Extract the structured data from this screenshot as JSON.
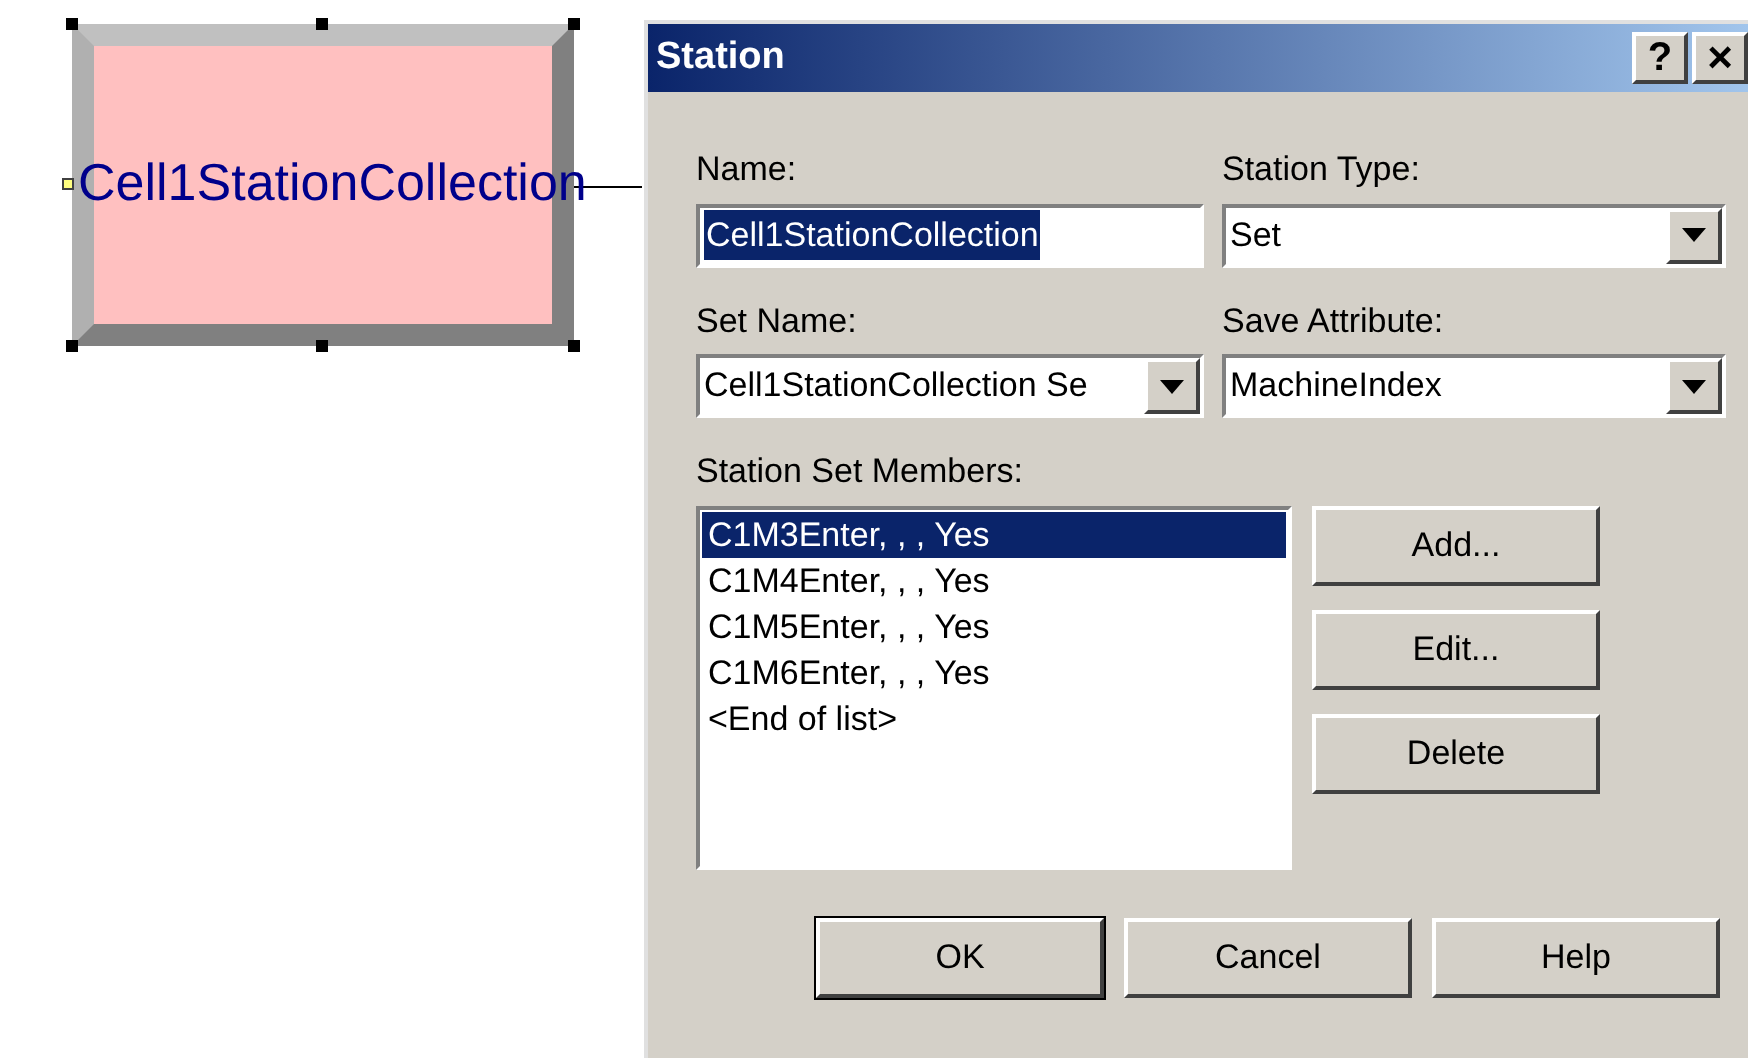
{
  "canvas": {
    "module": {
      "label": "Cell1StationCollection",
      "selected": true
    }
  },
  "dialog": {
    "title": "Station",
    "help_button": "?",
    "close_button": "×",
    "name": {
      "label": "Name:",
      "value": "Cell1StationCollection",
      "text_selected": true
    },
    "station_type": {
      "label": "Station Type:",
      "value": "Set"
    },
    "set_name": {
      "label": "Set Name:",
      "value": "Cell1StationCollection Se"
    },
    "save_attribute": {
      "label": "Save Attribute:",
      "value": "MachineIndex"
    },
    "members": {
      "label": "Station Set Members:",
      "items": [
        {
          "text": "C1M3Enter, , , Yes",
          "selected": true
        },
        {
          "text": "C1M4Enter, , , Yes",
          "selected": false
        },
        {
          "text": "C1M5Enter, , , Yes",
          "selected": false
        },
        {
          "text": "C1M6Enter, , , Yes",
          "selected": false
        },
        {
          "text": "<End of list>",
          "selected": false
        }
      ]
    },
    "side_buttons": [
      "Add...",
      "Edit...",
      "Delete"
    ],
    "buttons": [
      {
        "label": "OK",
        "default": true
      },
      {
        "label": "Cancel",
        "default": false
      },
      {
        "label": "Help",
        "default": false
      }
    ]
  }
}
